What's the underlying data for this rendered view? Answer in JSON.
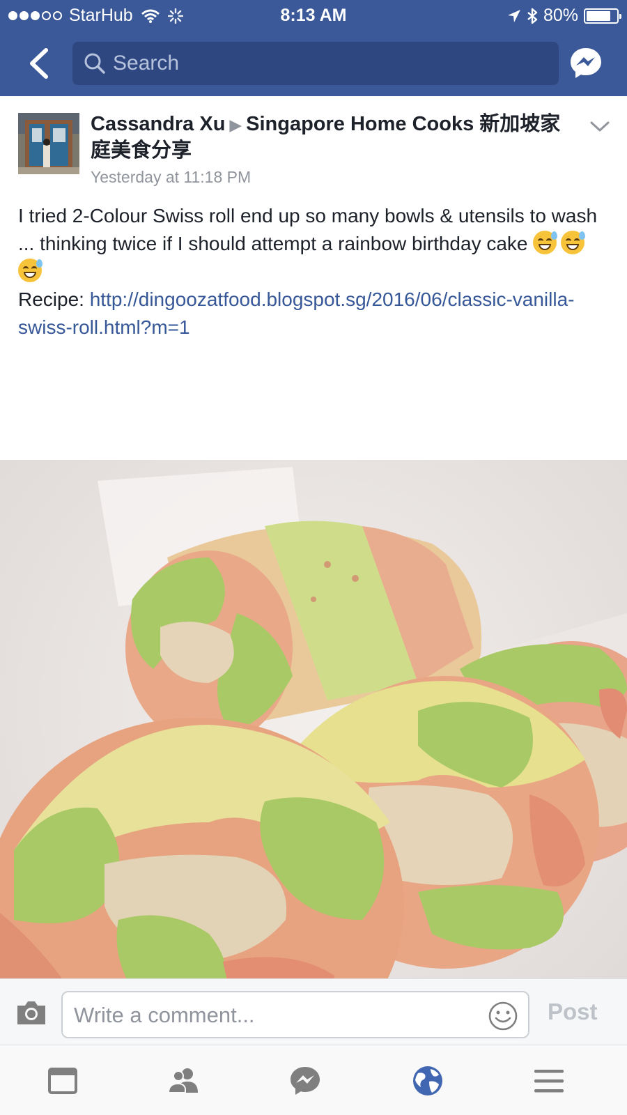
{
  "status_bar": {
    "carrier": "StarHub",
    "time": "8:13 AM",
    "battery": "80%",
    "battery_level": 0.8,
    "signal_bars_filled": 3,
    "signal_bars_total": 5
  },
  "nav": {
    "search_placeholder": "Search",
    "icons": [
      "back-icon",
      "search-icon",
      "messenger-icon"
    ]
  },
  "post": {
    "author": "Cassandra Xu",
    "group": "Singapore Home Cooks 新加坡家庭美食分享",
    "timestamp": "Yesterday at 11:18 PM",
    "text": "I tried 2-Colour Swiss roll end up so many bowls & utensils to wash ... thinking twice if I should attempt a rainbow birthday cake",
    "emojis": [
      "😅",
      "😅",
      "😅"
    ],
    "recipe_label": "Recipe:",
    "recipe_link": "http://dingoozatfood.blogspot.sg/2016/06/classic-vanilla-swiss-roll.html?m=1"
  },
  "comment_bar": {
    "placeholder": "Write a comment...",
    "post_label": "Post"
  },
  "tabbar": {
    "items": [
      "news-feed-icon",
      "friends-icon",
      "messenger-icon",
      "notifications-globe-icon",
      "menu-icon"
    ]
  },
  "colors": {
    "brand": "#3b5998",
    "search_bg": "#2e4780",
    "link": "#365899",
    "muted": "#90949c",
    "active_tab": "#4267b2"
  }
}
